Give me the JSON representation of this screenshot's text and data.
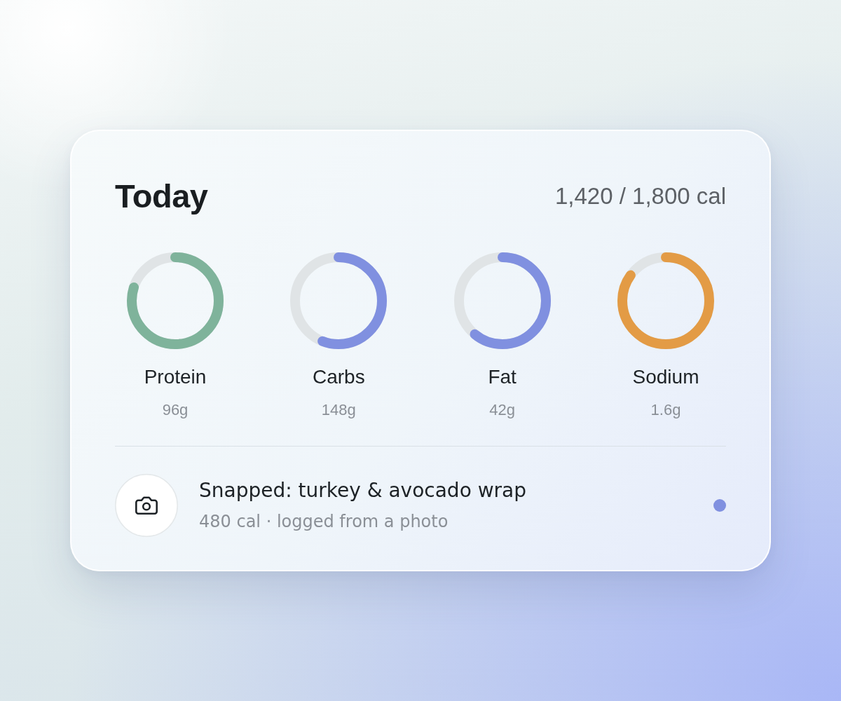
{
  "card": {
    "title": "Today",
    "calories": "1,420 / 1,800 cal",
    "nutrients": [
      {
        "name": "Protein",
        "amount": "96g",
        "level": 0.8,
        "color": "#7fb39b"
      },
      {
        "name": "Carbs",
        "amount": "148g",
        "level": 0.56,
        "color": "#8090e0"
      },
      {
        "name": "Fat",
        "amount": "42g",
        "level": 0.61,
        "color": "#8090e0"
      },
      {
        "name": "Sodium",
        "amount": "1.6g",
        "level": 0.85,
        "color": "#e39b45"
      }
    ],
    "log_entry": {
      "title": "Snapped: turkey & avocado wrap",
      "detail": "480 cal · logged from a photo",
      "unread": true
    }
  }
}
